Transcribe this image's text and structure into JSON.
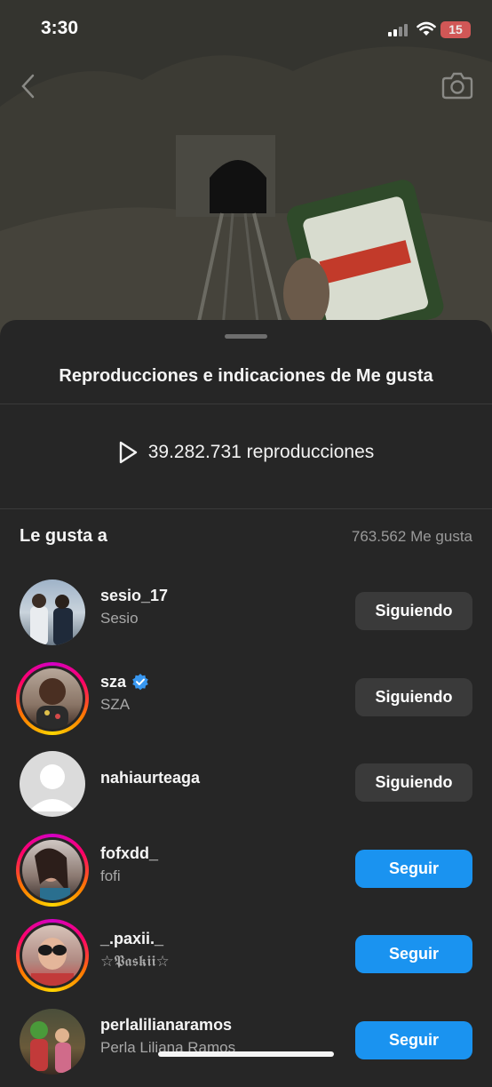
{
  "status_bar": {
    "time": "3:30",
    "battery": "15"
  },
  "sheet": {
    "title": "Reproducciones e indicaciones de Me gusta",
    "plays_text": "39.282.731 reproducciones",
    "likes_header": {
      "title": "Le gusta a",
      "count": "763.562 Me gusta"
    }
  },
  "users": [
    {
      "username": "sesio_17",
      "name": "Sesio",
      "verified": false,
      "ring": false,
      "button": "Siguiendo"
    },
    {
      "username": "sza",
      "name": "SZA",
      "verified": true,
      "ring": true,
      "button": "Siguiendo"
    },
    {
      "username": "nahiaurteaga",
      "name": "",
      "verified": false,
      "ring": false,
      "button": "Siguiendo"
    },
    {
      "username": "fofxdd_",
      "name": "fofi",
      "verified": false,
      "ring": true,
      "button": "Seguir"
    },
    {
      "username": "_.paxii._",
      "name": "☆𝕻𝖆𝖘𝖐𝖎𝖎☆",
      "verified": false,
      "ring": true,
      "button": "Seguir"
    },
    {
      "username": "perlalilianaramos",
      "name": "Perla Liliana Ramos",
      "verified": false,
      "ring": false,
      "button": "Seguir"
    }
  ],
  "colors": {
    "follow": "#1a93f0",
    "following": "#3a3a3a",
    "background": "#262626"
  }
}
